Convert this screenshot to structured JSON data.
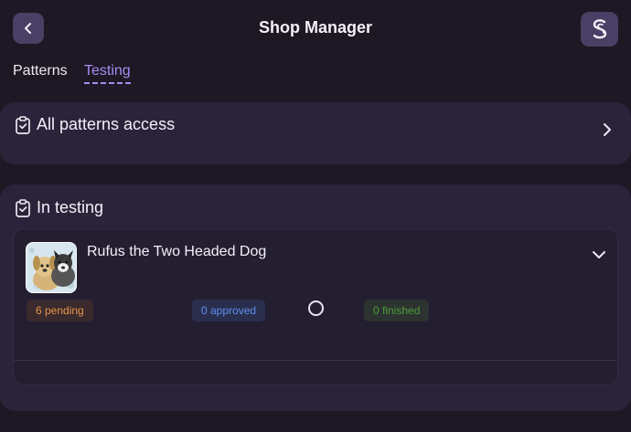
{
  "header": {
    "title": "Shop Manager",
    "back_icon": "chevron-left-icon",
    "shop_icon": "shop-logo-icon"
  },
  "tabs": [
    {
      "label": "Patterns",
      "active": false
    },
    {
      "label": "Testing",
      "active": true
    }
  ],
  "access_card": {
    "title": "All patterns access",
    "icon": "clipboard-check-icon"
  },
  "testing_card": {
    "title": "In testing",
    "icon": "clipboard-check-icon",
    "pattern": {
      "name": "Rufus the Two Headed Dog",
      "pending": "6 pending",
      "approved": "0 approved",
      "finished": "0 finished"
    }
  },
  "colors": {
    "background": "#1d1824",
    "card": "#2a2339",
    "accent": "#a98cf2",
    "pending": "#e79449",
    "approved": "#5f8ef0",
    "finished": "#4e9d3a"
  }
}
